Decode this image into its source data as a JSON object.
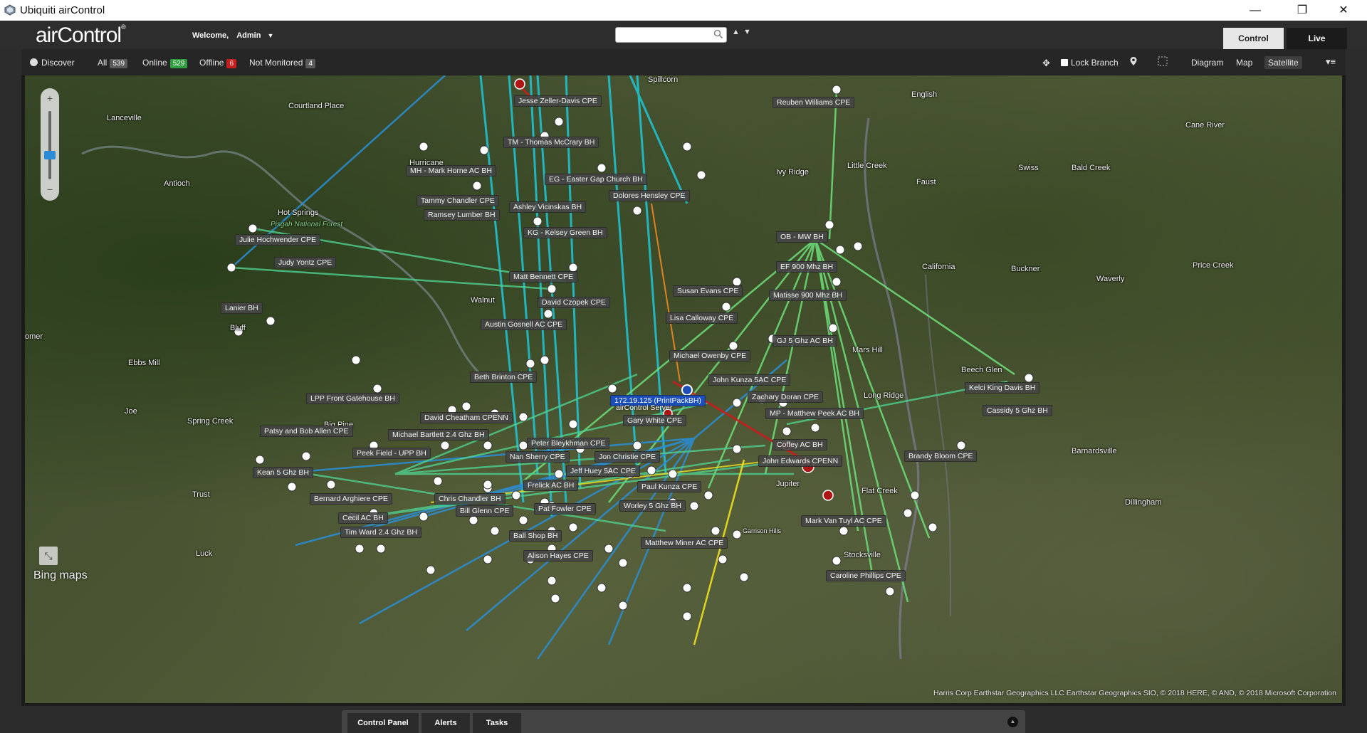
{
  "window": {
    "title": "Ubiquiti airControl",
    "minimize": "—",
    "restore": "❐",
    "close": "✕"
  },
  "header": {
    "logo": "airControl",
    "logo_mark": "®",
    "welcome_label": "Welcome,",
    "user": "Admin",
    "search_placeholder": "",
    "search_icon": "search-icon",
    "up": "▲",
    "down": "▼",
    "tabs": {
      "control": "Control",
      "live": "Live"
    }
  },
  "toolbar": {
    "discover": "Discover",
    "all_label": "All",
    "all_count": "539",
    "online_label": "Online",
    "online_count": "529",
    "offline_label": "Offline",
    "offline_count": "6",
    "not_monitored_label": "Not Monitored",
    "not_monitored_count": "4",
    "lock_branch": "Lock Branch",
    "views": {
      "diagram": "Diagram",
      "map": "Map",
      "satellite": "Satellite"
    },
    "active_view": "Satellite"
  },
  "map": {
    "places": [
      {
        "name": "Courtland Place"
      },
      {
        "name": "Lanceville"
      },
      {
        "name": "Antioch"
      },
      {
        "name": "Hot Springs"
      },
      {
        "name": "Pisgah National Forest"
      },
      {
        "name": "Bluff"
      },
      {
        "name": "Walnut"
      },
      {
        "name": "Ebbs Mill"
      },
      {
        "name": "Spring Creek"
      },
      {
        "name": "Joe"
      },
      {
        "name": "Trust"
      },
      {
        "name": "Luck"
      },
      {
        "name": "Spillcorn"
      },
      {
        "name": "English"
      },
      {
        "name": "Cane River"
      },
      {
        "name": "Little Creek"
      },
      {
        "name": "Ivy Ridge"
      },
      {
        "name": "Faust"
      },
      {
        "name": "Swiss"
      },
      {
        "name": "Bald Creek"
      },
      {
        "name": "California"
      },
      {
        "name": "Buckner"
      },
      {
        "name": "Price Creek"
      },
      {
        "name": "Waverly"
      },
      {
        "name": "Mars Hill"
      },
      {
        "name": "Beech Glen"
      },
      {
        "name": "Long Ridge"
      },
      {
        "name": "Barnardsville"
      },
      {
        "name": "Dillingham"
      },
      {
        "name": "Jupiter"
      },
      {
        "name": "Flat Creek"
      },
      {
        "name": "Stocksville"
      },
      {
        "name": "Big Pine"
      },
      {
        "name": "omer"
      },
      {
        "name": "Garrison Hills"
      }
    ],
    "nodes": [
      {
        "label": "Jesse Zeller-Davis CPE"
      },
      {
        "label": "TM - Thomas McCrary BH"
      },
      {
        "label": "MH - Mark Horne AC BH"
      },
      {
        "label": "Hurricane"
      },
      {
        "label": "EG - Easter Gap Church BH"
      },
      {
        "label": "Dolores Hensley CPE"
      },
      {
        "label": "Tammy Chandler CPE"
      },
      {
        "label": "Ashley Vicinskas BH"
      },
      {
        "label": "Ramsey Lumber BH"
      },
      {
        "label": "KG - Kelsey Green BH"
      },
      {
        "label": "Reuben Williams CPE"
      },
      {
        "label": "Julie Hochwender CPE"
      },
      {
        "label": "Judy Yontz CPE"
      },
      {
        "label": "OB - MW BH"
      },
      {
        "label": "EF 900 Mhz BH"
      },
      {
        "label": "Matt Bennett CPE"
      },
      {
        "label": "Susan Evans CPE"
      },
      {
        "label": "Matisse 900 Mhz BH"
      },
      {
        "label": "David Czopek CPE"
      },
      {
        "label": "Lanier BH"
      },
      {
        "label": "Lisa Calloway CPE"
      },
      {
        "label": "Austin Gosnell AC CPE"
      },
      {
        "label": "GJ 5 Ghz AC BH"
      },
      {
        "label": "Michael Owenby CPE"
      },
      {
        "label": "Beth Brinton CPE"
      },
      {
        "label": "John Kunza 5AC CPE"
      },
      {
        "label": "Kelci King Davis BH"
      },
      {
        "label": "LPP Front Gatehouse BH"
      },
      {
        "label": "Zachary Doran CPE"
      },
      {
        "label": "Cassidy 5 Ghz BH"
      },
      {
        "label": "MP - Matthew Peek AC BH"
      },
      {
        "label": "David Cheatham CPENN"
      },
      {
        "label": "Gary White CPE"
      },
      {
        "label": "Patsy and Bob Allen CPE"
      },
      {
        "label": "Michael Bartlett 2.4 Ghz BH"
      },
      {
        "label": "Coffey AC BH"
      },
      {
        "label": "Peter Bleykhman CPE"
      },
      {
        "label": "Brandy Bloom CPE"
      },
      {
        "label": "Peek Field - UPP BH"
      },
      {
        "label": "Nan Sherry CPE"
      },
      {
        "label": "Jon Christie CPE"
      },
      {
        "label": "John Edwards CPENN"
      },
      {
        "label": "Kean 5 Ghz BH"
      },
      {
        "label": "Jeff Huey 5AC CPE"
      },
      {
        "label": "Frelick AC BH"
      },
      {
        "label": "Paul Kunza CPE"
      },
      {
        "label": "Bernard Arghiere CPE"
      },
      {
        "label": "Chris Chandler BH"
      },
      {
        "label": "Worley 5 Ghz BH"
      },
      {
        "label": "Pat Fowler CPE"
      },
      {
        "label": "Bill Glenn CPE"
      },
      {
        "label": "Cecil AC BH"
      },
      {
        "label": "Mark Van Tuyl AC CPE"
      },
      {
        "label": "Tim Ward 2.4 Ghz BH"
      },
      {
        "label": "Ball Shop BH"
      },
      {
        "label": "Matthew Miner AC CPE"
      },
      {
        "label": "Alison Hayes CPE"
      },
      {
        "label": "Caroline Phillips CPE"
      }
    ],
    "server_label": "172.19.125 (PrintPackBH)",
    "server_sub": "airControl Server",
    "bing": "Bing maps",
    "copyright": "Harris Corp Earthstar Geographics LLC Earthstar Geographics SIO, © 2018 HERE, © AND, © 2018 Microsoft Corporation",
    "zoom_in": "+",
    "zoom_out": "−"
  },
  "bottom_panel": {
    "tabs": {
      "control_panel": "Control Panel",
      "alerts": "Alerts",
      "tasks": "Tasks"
    },
    "collapse": "▲"
  },
  "colors": {
    "link_cyan": "#1ec8d8",
    "link_blue": "#2a8fd8",
    "link_green": "#6fe07a",
    "link_yellow": "#f0e020",
    "link_orange": "#f08a20",
    "link_red": "#c81e1e",
    "node_offline": "#b01515"
  }
}
